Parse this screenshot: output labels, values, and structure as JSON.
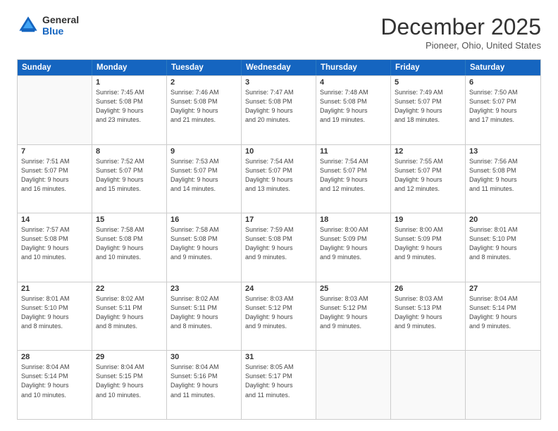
{
  "header": {
    "logo_line1": "General",
    "logo_line2": "Blue",
    "month": "December 2025",
    "location": "Pioneer, Ohio, United States"
  },
  "days_of_week": [
    "Sunday",
    "Monday",
    "Tuesday",
    "Wednesday",
    "Thursday",
    "Friday",
    "Saturday"
  ],
  "weeks": [
    [
      {
        "day": "",
        "info": ""
      },
      {
        "day": "1",
        "info": "Sunrise: 7:45 AM\nSunset: 5:08 PM\nDaylight: 9 hours\nand 23 minutes."
      },
      {
        "day": "2",
        "info": "Sunrise: 7:46 AM\nSunset: 5:08 PM\nDaylight: 9 hours\nand 21 minutes."
      },
      {
        "day": "3",
        "info": "Sunrise: 7:47 AM\nSunset: 5:08 PM\nDaylight: 9 hours\nand 20 minutes."
      },
      {
        "day": "4",
        "info": "Sunrise: 7:48 AM\nSunset: 5:08 PM\nDaylight: 9 hours\nand 19 minutes."
      },
      {
        "day": "5",
        "info": "Sunrise: 7:49 AM\nSunset: 5:07 PM\nDaylight: 9 hours\nand 18 minutes."
      },
      {
        "day": "6",
        "info": "Sunrise: 7:50 AM\nSunset: 5:07 PM\nDaylight: 9 hours\nand 17 minutes."
      }
    ],
    [
      {
        "day": "7",
        "info": "Sunrise: 7:51 AM\nSunset: 5:07 PM\nDaylight: 9 hours\nand 16 minutes."
      },
      {
        "day": "8",
        "info": "Sunrise: 7:52 AM\nSunset: 5:07 PM\nDaylight: 9 hours\nand 15 minutes."
      },
      {
        "day": "9",
        "info": "Sunrise: 7:53 AM\nSunset: 5:07 PM\nDaylight: 9 hours\nand 14 minutes."
      },
      {
        "day": "10",
        "info": "Sunrise: 7:54 AM\nSunset: 5:07 PM\nDaylight: 9 hours\nand 13 minutes."
      },
      {
        "day": "11",
        "info": "Sunrise: 7:54 AM\nSunset: 5:07 PM\nDaylight: 9 hours\nand 12 minutes."
      },
      {
        "day": "12",
        "info": "Sunrise: 7:55 AM\nSunset: 5:07 PM\nDaylight: 9 hours\nand 12 minutes."
      },
      {
        "day": "13",
        "info": "Sunrise: 7:56 AM\nSunset: 5:08 PM\nDaylight: 9 hours\nand 11 minutes."
      }
    ],
    [
      {
        "day": "14",
        "info": "Sunrise: 7:57 AM\nSunset: 5:08 PM\nDaylight: 9 hours\nand 10 minutes."
      },
      {
        "day": "15",
        "info": "Sunrise: 7:58 AM\nSunset: 5:08 PM\nDaylight: 9 hours\nand 10 minutes."
      },
      {
        "day": "16",
        "info": "Sunrise: 7:58 AM\nSunset: 5:08 PM\nDaylight: 9 hours\nand 9 minutes."
      },
      {
        "day": "17",
        "info": "Sunrise: 7:59 AM\nSunset: 5:08 PM\nDaylight: 9 hours\nand 9 minutes."
      },
      {
        "day": "18",
        "info": "Sunrise: 8:00 AM\nSunset: 5:09 PM\nDaylight: 9 hours\nand 9 minutes."
      },
      {
        "day": "19",
        "info": "Sunrise: 8:00 AM\nSunset: 5:09 PM\nDaylight: 9 hours\nand 9 minutes."
      },
      {
        "day": "20",
        "info": "Sunrise: 8:01 AM\nSunset: 5:10 PM\nDaylight: 9 hours\nand 8 minutes."
      }
    ],
    [
      {
        "day": "21",
        "info": "Sunrise: 8:01 AM\nSunset: 5:10 PM\nDaylight: 9 hours\nand 8 minutes."
      },
      {
        "day": "22",
        "info": "Sunrise: 8:02 AM\nSunset: 5:11 PM\nDaylight: 9 hours\nand 8 minutes."
      },
      {
        "day": "23",
        "info": "Sunrise: 8:02 AM\nSunset: 5:11 PM\nDaylight: 9 hours\nand 8 minutes."
      },
      {
        "day": "24",
        "info": "Sunrise: 8:03 AM\nSunset: 5:12 PM\nDaylight: 9 hours\nand 9 minutes."
      },
      {
        "day": "25",
        "info": "Sunrise: 8:03 AM\nSunset: 5:12 PM\nDaylight: 9 hours\nand 9 minutes."
      },
      {
        "day": "26",
        "info": "Sunrise: 8:03 AM\nSunset: 5:13 PM\nDaylight: 9 hours\nand 9 minutes."
      },
      {
        "day": "27",
        "info": "Sunrise: 8:04 AM\nSunset: 5:14 PM\nDaylight: 9 hours\nand 9 minutes."
      }
    ],
    [
      {
        "day": "28",
        "info": "Sunrise: 8:04 AM\nSunset: 5:14 PM\nDaylight: 9 hours\nand 10 minutes."
      },
      {
        "day": "29",
        "info": "Sunrise: 8:04 AM\nSunset: 5:15 PM\nDaylight: 9 hours\nand 10 minutes."
      },
      {
        "day": "30",
        "info": "Sunrise: 8:04 AM\nSunset: 5:16 PM\nDaylight: 9 hours\nand 11 minutes."
      },
      {
        "day": "31",
        "info": "Sunrise: 8:05 AM\nSunset: 5:17 PM\nDaylight: 9 hours\nand 11 minutes."
      },
      {
        "day": "",
        "info": ""
      },
      {
        "day": "",
        "info": ""
      },
      {
        "day": "",
        "info": ""
      }
    ]
  ]
}
